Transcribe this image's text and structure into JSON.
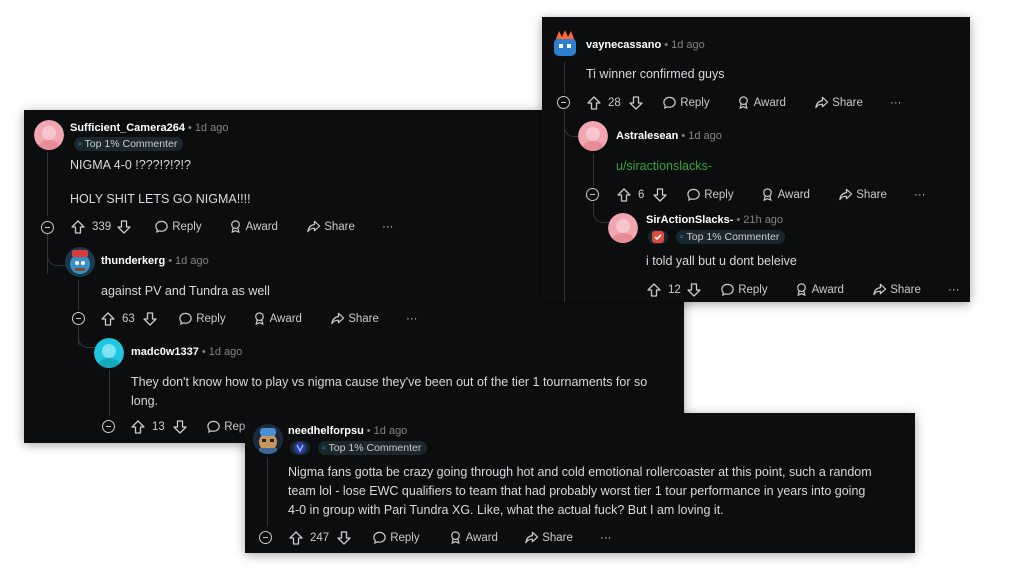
{
  "comments": {
    "sufficient": {
      "username": "Sufficient_Camera264",
      "time": "1d ago",
      "badge": "Top 1% Commenter",
      "lines": [
        "NIGMA 4-0 !???!?!?!?",
        "HOLY SHIT LETS GO NIGMA!!!!"
      ],
      "votes": "339"
    },
    "thunderkerg": {
      "username": "thunderkerg",
      "time": "1d ago",
      "text": "against PV and Tundra as well",
      "votes": "63"
    },
    "madc": {
      "username": "madc0w1337",
      "time": "1d ago",
      "lines": [
        "They don't know how to play vs nigma cause they've been out of the tier 1 tournaments for so",
        "long."
      ],
      "votes": "13",
      "reply_partial": "Rep"
    },
    "vayne": {
      "username": "vaynecassano",
      "time": "1d ago",
      "text": "Ti winner confirmed guys",
      "votes": "28"
    },
    "astralesean": {
      "username": "Astralesean",
      "time": "1d ago",
      "text": "u/siractionslacks-",
      "votes": "6"
    },
    "siraction": {
      "username": "SirActionSlacks-",
      "time": "21h ago",
      "badge": "Top 1% Commenter",
      "text": "i told yall but u dont beleive",
      "votes": "12"
    },
    "needhelf": {
      "username": "needhelforpsu",
      "time": "1d ago",
      "badge": "Top 1% Commenter",
      "lines": [
        "Nigma fans gotta be crazy going through hot and cold emotional rollercoaster at this point, such a random",
        "team lol - lose EWC qualifiers to team that had probably worst tier 1 tour performance in years into going",
        "4-0 in group with Pari Tundra XG. Like, what the actual fuck? But I am loving it."
      ],
      "votes": "247"
    }
  },
  "labels": {
    "reply": "Reply",
    "award": "Award",
    "share": "Share",
    "more": "···",
    "dot": "•"
  },
  "colors": {
    "background": "#0b0d0e",
    "text": "#d7dadc",
    "muted": "#818384",
    "link": "#3ba43b",
    "badge_bg": "#1a282d",
    "badge_icon": "#3aa0ff"
  },
  "icons": [
    "upvote-icon",
    "downvote-icon",
    "reply-icon",
    "award-icon",
    "share-icon",
    "collapse-icon",
    "more-icon"
  ]
}
